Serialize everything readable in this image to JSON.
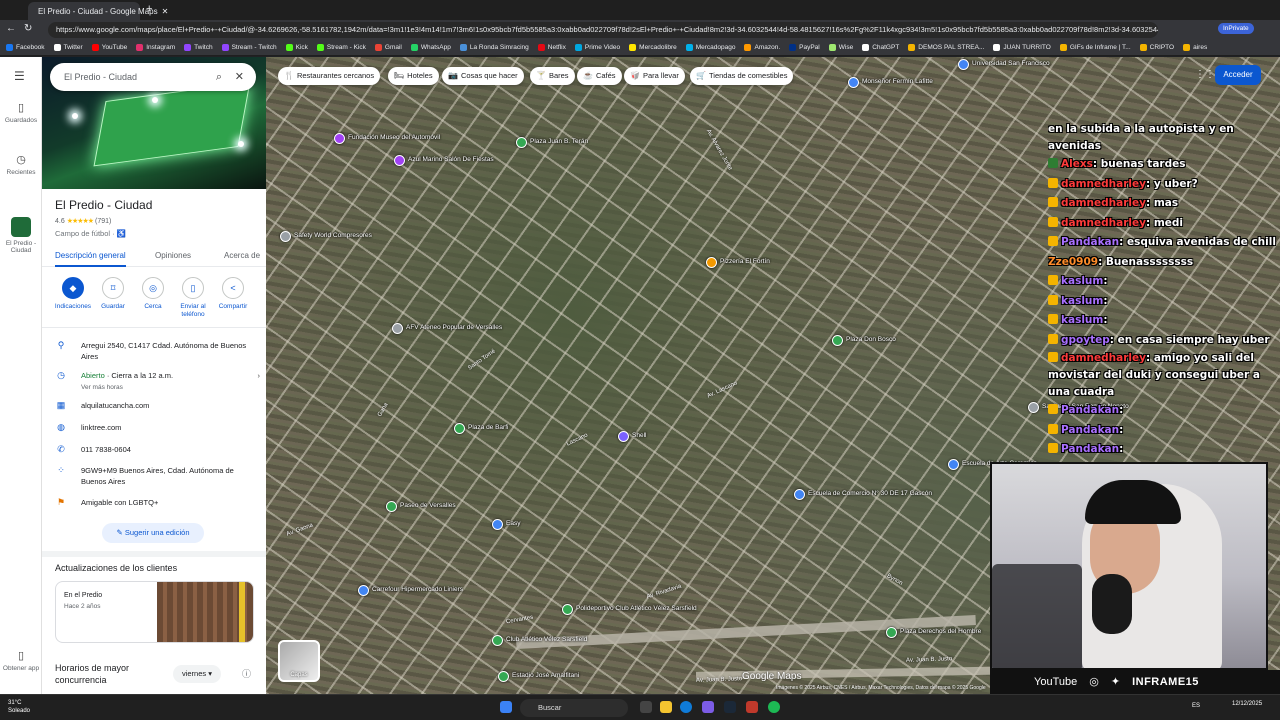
{
  "browser": {
    "tab_title": "El Predio - Ciudad - Google Maps",
    "url": "https://www.google.com/maps/place/El+Predio+-+Ciudad/@-34.6269626,-58.5161782,1942m/data=!3m1!1e3!4m14!1m7!3m6!1s0x95bcb7fd5b5585a3:0xabb0ad022709f78d!2sEl+Predio+-+Ciudad!8m2!3d-34.6032544!4d-58.4815627!16s%2Fg%2F11k4xgc934!3m5!1s0x95bcb7fd5b5585a3:0xabb0ad022709f78d!8m2!3d-34.6032544!4d-58.4815627",
    "profile_label": "InPrivate",
    "bookmarks": [
      {
        "label": "Facebook",
        "color": "#1877f2"
      },
      {
        "label": "Twitter",
        "color": "#ffffff"
      },
      {
        "label": "YouTube",
        "color": "#ff0000"
      },
      {
        "label": "Instagram",
        "color": "#e1306c"
      },
      {
        "label": "Twitch",
        "color": "#9146ff"
      },
      {
        "label": "Stream - Twitch",
        "color": "#9146ff"
      },
      {
        "label": "Kick",
        "color": "#53fc18"
      },
      {
        "label": "Stream - Kick",
        "color": "#53fc18"
      },
      {
        "label": "Gmail",
        "color": "#ea4335"
      },
      {
        "label": "WhatsApp",
        "color": "#25d366"
      },
      {
        "label": "La Ronda Simracing",
        "color": "#4a90d9"
      },
      {
        "label": "Netflix",
        "color": "#e50914"
      },
      {
        "label": "Prime Video",
        "color": "#00a8e1"
      },
      {
        "label": "Mercadolibre",
        "color": "#ffe600"
      },
      {
        "label": "Mercadopago",
        "color": "#00b1ea"
      },
      {
        "label": "Amazon.",
        "color": "#ff9900"
      },
      {
        "label": "PayPal",
        "color": "#003087"
      },
      {
        "label": "Wise",
        "color": "#9fe870"
      },
      {
        "label": "ChatGPT",
        "color": "#ffffff"
      },
      {
        "label": "DEMOS PAL STREA...",
        "color": "#f4b400"
      },
      {
        "label": "JUAN TURRITO",
        "color": "#ffffff"
      },
      {
        "label": "GIFs de Inframe | T...",
        "color": "#f4b400"
      },
      {
        "label": "CRIPTO",
        "color": "#f4b400"
      },
      {
        "label": "aires",
        "color": "#f4b400"
      }
    ]
  },
  "rail": {
    "saved": "Guardados",
    "recent": "Recientes",
    "place": "El Predio - Ciudad",
    "get_app": "Obtener app"
  },
  "panel": {
    "search_value": "El Predio - Ciudad",
    "title": "El Predio - Ciudad",
    "rating": "4.6",
    "stars": "★★★★★",
    "reviews": "(791)",
    "type": "Campo de fútbol · ♿",
    "tabs": [
      "Descripción general",
      "Opiniones",
      "Acerca de"
    ],
    "actions": [
      {
        "label": "Indicaciones",
        "icon": "◆"
      },
      {
        "label": "Guardar",
        "icon": "⌑"
      },
      {
        "label": "Cerca",
        "icon": "◎"
      },
      {
        "label": "Enviar al teléfono",
        "icon": "▯"
      },
      {
        "label": "Compartir",
        "icon": "<"
      }
    ],
    "address": "Arregui 2540, C1417 Cdad. Autónoma de Buenos Aires",
    "open_status": "Abierto",
    "open_detail": " · Cierra a la 12 a.m.",
    "hours_link": "Ver más horas",
    "website1": "alquilatucancha.com",
    "website2": "linktree.com",
    "phone": "011 7838-0604",
    "plus_code": "9GW9+M9 Buenos Aires, Cdad. Autónoma de Buenos Aires",
    "lgbtq": "Amigable con LGBTQ+",
    "suggest": "Sugerir una edición",
    "updates_title": "Actualizaciones de los clientes",
    "update_place": "En el Predio",
    "update_time": "Hace 2 años",
    "busy_title": "Horarios de mayor concurrencia",
    "day": "viernes"
  },
  "map": {
    "chips": [
      {
        "icon": "🍴",
        "label": "Restaurantes cercanos"
      },
      {
        "icon": "🛏",
        "label": "Hoteles"
      },
      {
        "icon": "📷",
        "label": "Cosas que hacer"
      },
      {
        "icon": "🍸",
        "label": "Bares"
      },
      {
        "icon": "☕",
        "label": "Cafés"
      },
      {
        "icon": "🥡",
        "label": "Para llevar"
      },
      {
        "icon": "🛒",
        "label": "Tiendas de comestibles"
      }
    ],
    "signin": "Acceder",
    "layers": "Capas",
    "logo": "Google Maps",
    "footer": "Imágenes © 2025 Airbus, CNES / Airbus, Maxar Technologies, Datos del mapa © 2025 Google",
    "places": [
      {
        "label": "Fundación Museo del Automóvil",
        "color": "#a142f4"
      },
      {
        "label": "Azul Marino Salón De Fiestas",
        "color": "#a142f4"
      },
      {
        "label": "Plaza Juan B. Terán",
        "color": "#34a853"
      },
      {
        "label": "Safety World Compresores",
        "color": "#9aa0a6"
      },
      {
        "label": "Pizzería El Fortín",
        "color": "#f29900"
      },
      {
        "label": "AFV Ateneo Popular de Versalles",
        "color": "#9aa0a6"
      },
      {
        "label": "Plaza Don Bosco",
        "color": "#34a853"
      },
      {
        "label": "Shell",
        "color": "#7b61ff"
      },
      {
        "label": "Plaza de Barfi",
        "color": "#34a853"
      },
      {
        "label": "Paseo de Versalles",
        "color": "#34a853"
      },
      {
        "label": "Easy",
        "color": "#4285f4"
      },
      {
        "label": "Escuela de Comercio N° 30 DE 17 Gascón",
        "color": "#4285f4"
      },
      {
        "label": "Carrefour Hipermercado Liniers",
        "color": "#4285f4"
      },
      {
        "label": "Club Atlético Vélez Sarsfield",
        "color": "#34a853"
      },
      {
        "label": "Polideportivo Club Atlético Vélez Sarsfield",
        "color": "#34a853"
      },
      {
        "label": "Estadio José Amalfitani",
        "color": "#34a853"
      },
      {
        "label": "Plaza Derechos del Hombre",
        "color": "#34a853"
      },
      {
        "label": "Escuela de Arte Ceramico",
        "color": "#4285f4"
      },
      {
        "label": "Santuario San Ramón Nonato",
        "color": "#9aa0a6"
      },
      {
        "label": "Universidad San Francisco",
        "color": "#4285f4"
      },
      {
        "label": "Monseñor Fermín Lafitte",
        "color": "#4285f4"
      }
    ],
    "streets": [
      "Av. Juan B. Justo",
      "Av. Juan B. Justo",
      "Av. Rivadavia",
      "Bynon",
      "Av. Lascano",
      "Santo Tomé",
      "Gana",
      "Av. Alvarez Jonte",
      "Cervantes",
      "Av. Gaona",
      "Lascano",
      "Av. Ricardo Balbín",
      "Av. Gral. Paz"
    ]
  },
  "chat": [
    {
      "user": "",
      "text": "en la subida a la autopista y en avenidas",
      "badge": ""
    },
    {
      "user": "Alexs",
      "text": ": buenas tardes",
      "badge": "#2e7d32",
      "ucolor": "#ff3b3b"
    },
    {
      "user": "damnedharley",
      "text": ": y uber?",
      "badge": "#f4b400",
      "ucolor": "#ff3b3b"
    },
    {
      "user": "damnedharley",
      "text": ": mas",
      "badge": "#f4b400",
      "ucolor": "#ff3b3b"
    },
    {
      "user": "damnedharley",
      "text": ": medi",
      "badge": "#f4b400",
      "ucolor": "#ff3b3b"
    },
    {
      "user": "Pandakan",
      "text": ": esquiva avenidas de chill",
      "badge": "#f4b400",
      "ucolor": "#a970ff"
    },
    {
      "user": "Zze0909",
      "text": ": Buenassssssss",
      "badge": "",
      "ucolor": "#ff8c2a"
    },
    {
      "user": "kaslum",
      "text": ": ",
      "badge": "#f4b400",
      "ucolor": "#a970ff"
    },
    {
      "user": "kaslum",
      "text": ": ",
      "badge": "#f4b400",
      "ucolor": "#a970ff"
    },
    {
      "user": "kaslum",
      "text": ": ",
      "badge": "#f4b400",
      "ucolor": "#a970ff"
    },
    {
      "user": "gpoytep",
      "text": ": en casa siempre hay uber",
      "badge": "#f4b400",
      "ucolor": "#a970ff"
    },
    {
      "user": "damnedharley",
      "text": ": amigo yo sali del movistar del duki y consegui uber a una cuadra",
      "badge": "#f4b400",
      "ucolor": "#ff3b3b"
    },
    {
      "user": "Pandakan",
      "text": ": ",
      "badge": "#f4b400",
      "ucolor": "#a970ff"
    },
    {
      "user": "Pandakan",
      "text": ": ",
      "badge": "#f4b400",
      "ucolor": "#a970ff"
    },
    {
      "user": "Pandakan",
      "text": ": ",
      "badge": "#f4b400",
      "ucolor": "#a970ff"
    }
  ],
  "stream": {
    "youtube": "YouTube",
    "brand": "INFRAME15"
  },
  "taskbar": {
    "temp": "31°C",
    "weather": "Soleado",
    "search": "Buscar",
    "lang": "ES",
    "date": "12/12/2025"
  }
}
